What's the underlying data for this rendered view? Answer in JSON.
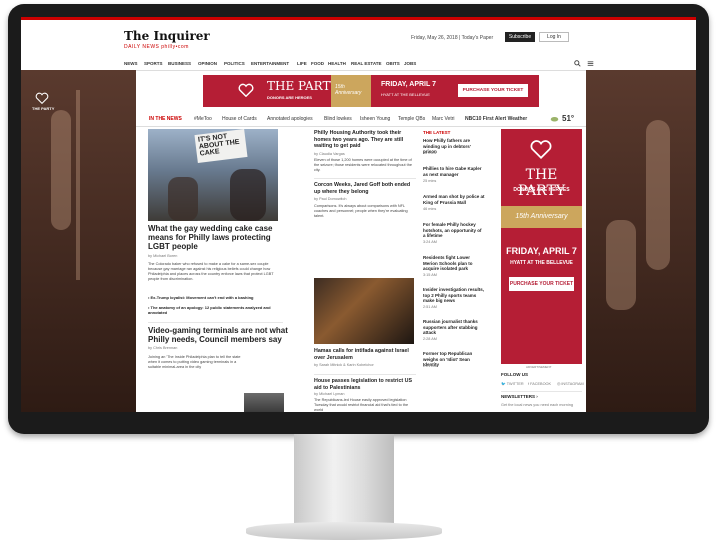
{
  "site": {
    "logo": "The Inquirer",
    "logo_sub": "DAILY NEWS  philly•com",
    "date": "Friday, May 26, 2018  |  Today's Paper",
    "subscribe_label": "Subscribe",
    "login_label": "Log In"
  },
  "nav": {
    "items": [
      "NEWS",
      "SPORTS",
      "BUSINESS",
      "OPINION",
      "POLITICS",
      "ENTERTAINMENT",
      "LIFE",
      "FOOD",
      "HEALTH",
      "REAL ESTATE",
      "OBITS",
      "JOBS"
    ]
  },
  "topics": {
    "items": [
      "IN THE NEWS",
      "#MeToo",
      "House of Cards",
      "Annotated apologies",
      "Blind lowkes",
      "Isheen Young",
      "Temple QBs",
      "Marc Vetri",
      "NBC10 First Alert Weather"
    ],
    "temperature": "51°"
  },
  "banner": {
    "brand": "THE PARTY",
    "brand_sub": "DONORS ARE HEROES",
    "anniversary": "15th Anniversary",
    "event_date": "FRIDAY, APRIL 7",
    "event_place": "HYATT AT THE BELLEVUE",
    "cta": "PURCHASE YOUR TICKET",
    "left_brand": "THE PARTY"
  },
  "main": {
    "hero_sign": "IT'S NOT ABOUT THE CAKE",
    "hero_headline": "What the gay wedding cake case means for Philly laws protecting LGBT people",
    "hero_byline": "by Michael Boren",
    "hero_body": "The Colorado baker who refused to make a cake for a same-sex couple because gay marriage ran against his religious beliefs could change how Philadelphia and places across the country enforce laws that protect LGBT people from discrimination.",
    "bullet1": "Ex-Trump loyalist: Movement can't end with a bashing",
    "bullet2": "The anatomy of an apology: 12 public statements analyzed and annotated",
    "second_headline": "Video-gaming terminals are not what Philly needs, Council members say",
    "second_byline": "by Chris Brennan",
    "second_body": "Joining an 'The Inside Philadelphia plan to tell the state when it comes to putting video gaming terminals in a suitable minimal-area in the city"
  },
  "center": {
    "story1_headline": "Philly Housing Authority took their homes two years ago. They are still waiting to get paid",
    "story1_byline": "by Claudia Vargas",
    "story1_body": "Eleven of those 1,200 homes were occupied at the time of the seizure; those residents were relocated throughout the city.",
    "story2_headline": "Corcon Weeks, Jared Goff both ended up where they belong",
    "story2_byline": "by Paul Domowitch",
    "story2_body": "Comparisons. It's always about comparisons with NFL coaches and personnel; people when they're evaluating talent.",
    "story3_headline": "Hamas calls for intifada against Israel over Jerusalem",
    "story3_byline": "by Sarah Mitnick & Karin Kobelchor",
    "story4_headline": "House passes legislation to restrict US aid to Palestinians",
    "story4_byline": "by Michael Lyman",
    "story4_body": "The Republicans-led House easily approved legislation Tuesday that would restrict financial aid that's tied to the world"
  },
  "latest": {
    "header": "THE LATEST",
    "items": [
      {
        "title": "How Philly fathers are winding up in debtors' prison",
        "time": "16 mins"
      },
      {
        "title": "Phillies to hire Gabe Kapler as next manager",
        "time": "25 mins"
      },
      {
        "title": "Armed man shot by police at King of Prussia Mall",
        "time": "46 mins"
      },
      {
        "title": "For female Philly hockey hotshots, an opportunity of a lifetime",
        "time": "3:24 AM"
      },
      {
        "title": "Residents fight Lower Merion Schools plan to acquire isolated park",
        "time": "3:15 AM"
      },
      {
        "title": "Insider investigation results, top 2 Philly sports teams make big news",
        "time": "2:51 AM"
      },
      {
        "title": "Russian journalist thanks supporters after stabbing attack",
        "time": "2:28 AM"
      },
      {
        "title": "Former top Republican weighs on 'Idiot' Sean Identity",
        "time": "2:21 AM"
      }
    ]
  },
  "sidebar": {
    "advertisement": "ADVERTISEMENT",
    "follow_us": "FOLLOW US",
    "twitter": "TWITTER",
    "facebook": "FACEBOOK",
    "instagram": "INSTAGRAM",
    "newsletters": "NEWSLETTERS ›",
    "newsletter_text": "Get the local news you need each morning"
  },
  "colors": {
    "brand_red": "#b51e35",
    "accent_gold": "#e8c66a"
  }
}
